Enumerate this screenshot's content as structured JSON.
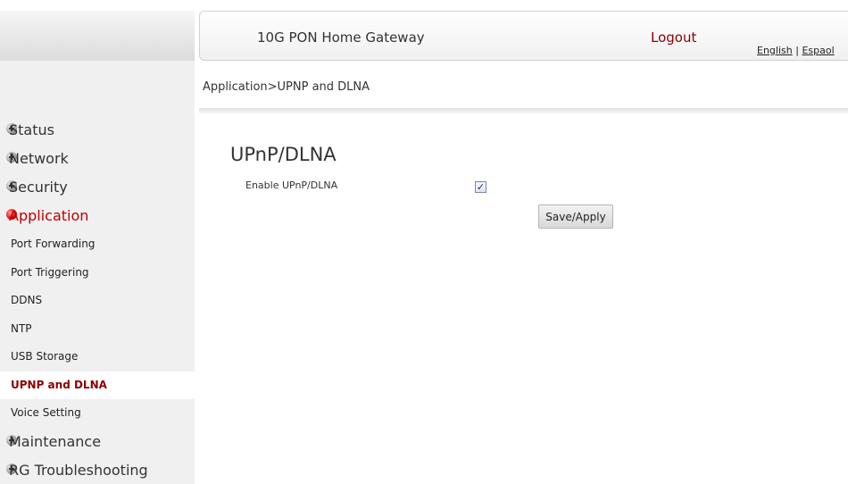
{
  "header": {
    "gateway_title": "10G PON Home Gateway",
    "logout_label": "Logout",
    "lang_english": "English",
    "lang_separator": " | ",
    "lang_spanish": "Espaol"
  },
  "breadcrumb": "Application>UPNP and DLNA",
  "sidebar": {
    "status": "Status",
    "network": "Network",
    "security": "Security",
    "application": "Application",
    "sub_items": {
      "port_forwarding": "Port Forwarding",
      "port_triggering": "Port Triggering",
      "ddns": "DDNS",
      "ntp": "NTP",
      "usb_storage": "USB Storage",
      "upnp_dlna": "UPNP and DLNA",
      "voice_setting": "Voice Setting"
    },
    "maintenance": "Maintenance",
    "rg_troubleshooting": "RG Troubleshooting"
  },
  "main": {
    "title": "UPnP/DLNA",
    "enable_label": "Enable UPnP/DLNA",
    "enable_checked": true,
    "checkmark": "✓",
    "save_label": "Save/Apply"
  },
  "colors": {
    "active_red": "#c00000",
    "selected_text": "#8b0000",
    "sidebar_bg": "#f0f0f0"
  }
}
